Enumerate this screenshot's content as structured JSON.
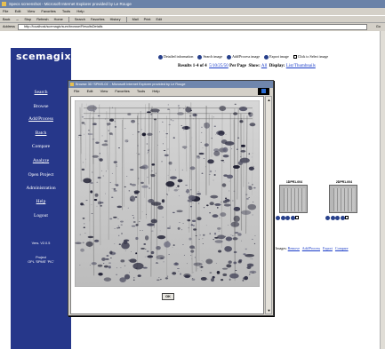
{
  "window": {
    "title": "Specs screenshot - Microsoft Internet Explorer provided by Le Rouge",
    "menu": [
      "File",
      "Edit",
      "View",
      "Favorites",
      "Tools",
      "Help"
    ],
    "toolbar": [
      "Back",
      "→",
      "Stop",
      "Refresh",
      "Home",
      "Search",
      "Favorites",
      "History",
      "Mail",
      "Print",
      "Edit"
    ],
    "address_label": "Address",
    "address_value": "http://localhost/scemagix/sum/browse/ResultsDetails",
    "go_label": "Go"
  },
  "sidebar": {
    "logo_text": "scemagix",
    "logo_tm": "™",
    "nav": [
      "Search",
      "Browse",
      "Add/Process",
      "Batch",
      "Compare",
      "Analyze",
      "Open Project",
      "Administration",
      "Help",
      "Logout"
    ],
    "version": "Vers. V2.0.5",
    "project_label": "Project",
    "project_value": "OPL 'SPMS' 'PIC'"
  },
  "legend": {
    "items": [
      {
        "type": "dot",
        "label": "Detailed information"
      },
      {
        "type": "dot",
        "label": "Search image"
      },
      {
        "type": "dot",
        "label": "Add/Process image"
      },
      {
        "type": "dot",
        "label": "Export image"
      },
      {
        "type": "box",
        "label": "Click to Select image"
      }
    ]
  },
  "results": {
    "text": "Results 1-4 of 4",
    "per_page_options": "5/10/25/50",
    "per_page_label": "Per Page",
    "show_label": "Show:",
    "show_value": "All",
    "display_label": "Display:",
    "display_value": "List/Thumbnails"
  },
  "thumbnails": [
    {
      "label": "1DPR1-004"
    },
    {
      "label": "2DPR1-004"
    }
  ],
  "images_actions": {
    "label": "Images:",
    "links": [
      "Remove",
      "Add/Process",
      "Export",
      "Compare"
    ]
  },
  "popup": {
    "title": "Browse 3D 'SPMS-01' - Microsoft Internet Explorer provided by Le Rouge",
    "menu": [
      "File",
      "Edit",
      "View",
      "Favorites",
      "Tools",
      "Help"
    ],
    "ok_label": "OK",
    "scroll_up": "▲",
    "scroll_down": "▼"
  }
}
